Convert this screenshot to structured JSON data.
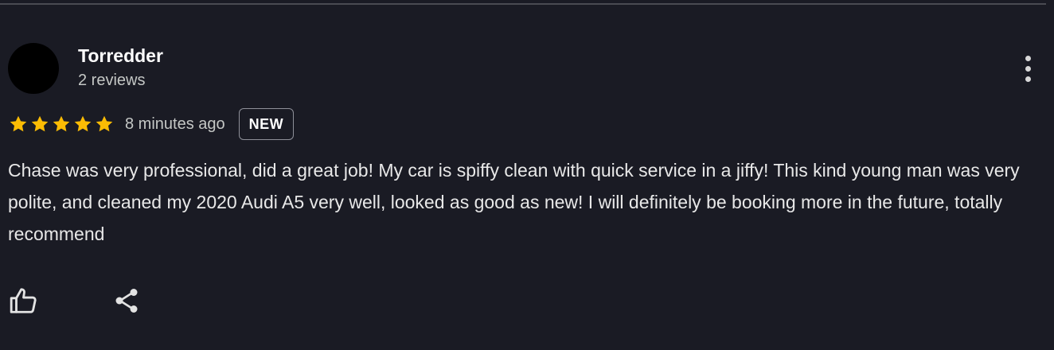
{
  "review": {
    "author": {
      "name": "Torredder",
      "reviews_count": "2 reviews",
      "avatar_color": "#000000"
    },
    "rating": 5,
    "rating_max": 5,
    "star_color": "#fbbc04",
    "time_ago": "8 minutes ago",
    "badge": "NEW",
    "text": "Chase was very professional, did a great job! My car is spiffy clean with quick service in a jiffy! This kind young man was very polite, and cleaned my 2020 Audi A5 very well, looked as good as new! I will definitely be booking more in the future, totally recommend"
  },
  "actions": {
    "like_icon": "thumbs-up-icon",
    "share_icon": "share-icon",
    "more_icon": "more-vertical-icon"
  },
  "theme": {
    "background": "#1a1b24"
  }
}
